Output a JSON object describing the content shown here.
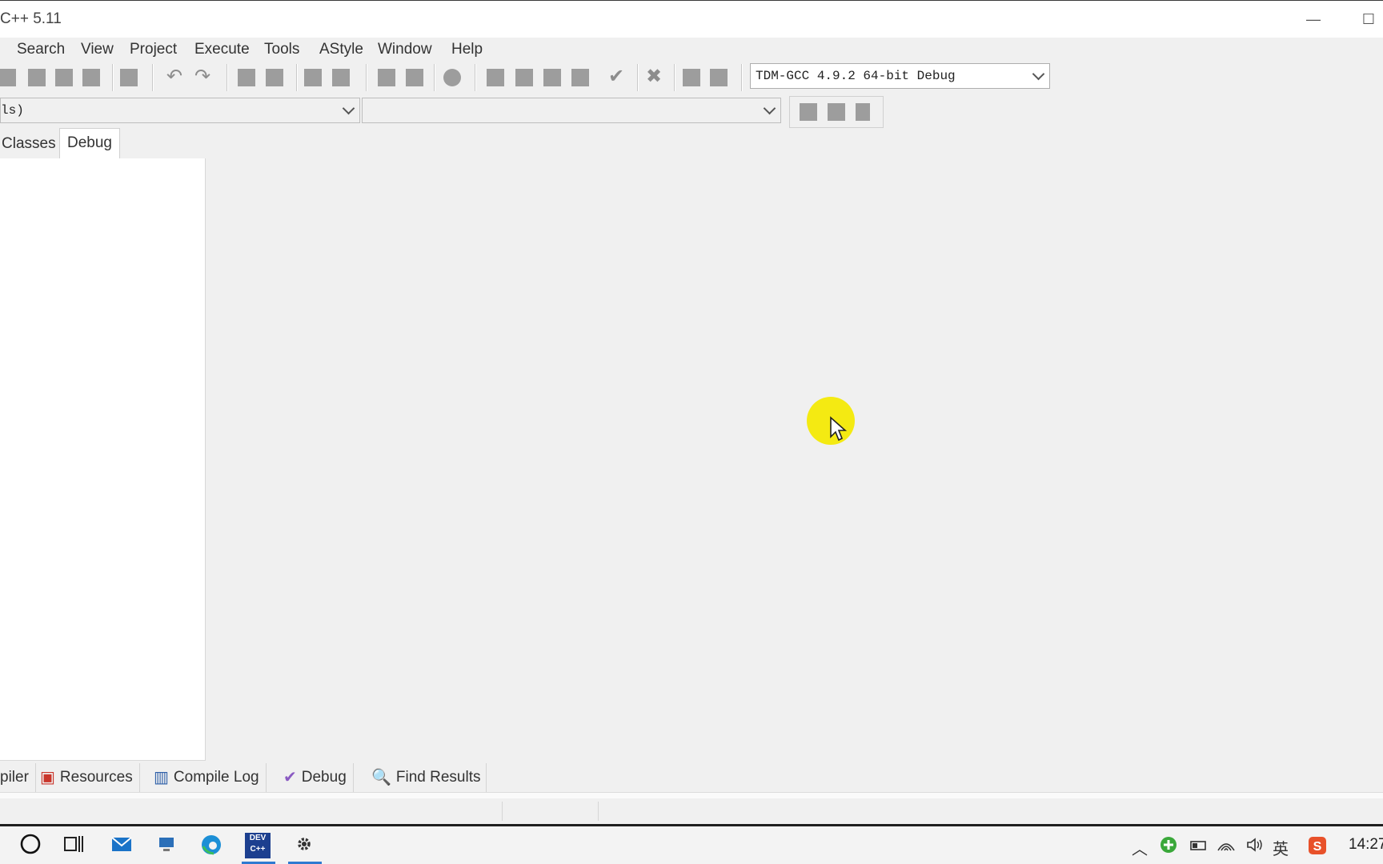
{
  "window": {
    "title": "C++ 5.11",
    "minimize_glyph": "—",
    "maximize_glyph": "☐"
  },
  "menu": [
    "Search",
    "View",
    "Project",
    "Execute",
    "Tools",
    "AStyle",
    "Window",
    "Help"
  ],
  "toolbar": {
    "compiler_profile": "TDM-GCC 4.9.2 64-bit Debug"
  },
  "class_browser": {
    "class_value": "ls)",
    "member_value": ""
  },
  "left_tabs": [
    "Classes",
    "Debug"
  ],
  "bottom_tabs": [
    {
      "label": "piler",
      "icon": "compiler-icon"
    },
    {
      "label": "Resources",
      "icon": "resources-icon"
    },
    {
      "label": "Compile Log",
      "icon": "compile-log-icon"
    },
    {
      "label": "Debug",
      "icon": "debug-check-icon"
    },
    {
      "label": "Find Results",
      "icon": "find-results-icon"
    }
  ],
  "taskbar": {
    "clock": "14:27",
    "ime_label": "英",
    "icons": [
      "cortana-circle-icon",
      "task-view-icon",
      "mail-icon",
      "desktop-icon",
      "edge-icon",
      "dev-cpp-icon",
      "settings-gear-icon"
    ]
  },
  "colors": {
    "accent": "#2e7ad1",
    "cursor_highlight": "#f4ea12",
    "toolbar_icon": "#9d9d9d"
  }
}
